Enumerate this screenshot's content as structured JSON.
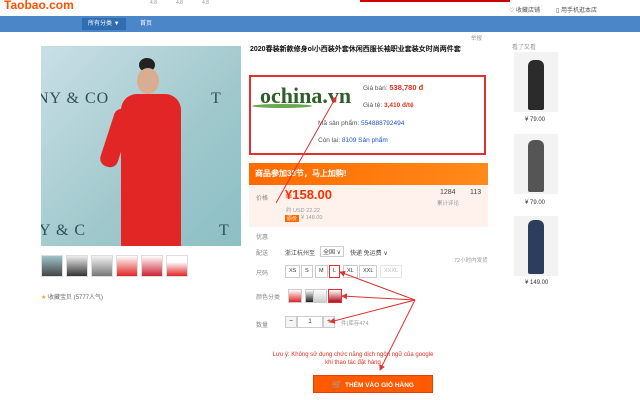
{
  "header": {
    "logo": "Taobao.com",
    "mini": [
      "4.8",
      "4.8",
      "4.8"
    ],
    "links": [
      "收藏店铺",
      "用手机逛本店"
    ]
  },
  "nav": {
    "items": [
      {
        "label": "所有分类 ▼"
      },
      {
        "label": "首页"
      }
    ]
  },
  "gallery": {
    "brand_left": "NY & CO",
    "brand_right": "T",
    "brand_bottom_left": "Y & C",
    "brand_bottom_right": "T",
    "favorites": "收藏宝贝 (5777人气)"
  },
  "product": {
    "report": "举报",
    "title": "2020春装新款修身ol小西装外套休闲西服长袖职业套装女时尚两件套",
    "ochina": {
      "logo": "ochina.vn",
      "price_label": "Giá bán:",
      "price_value": "538,780 đ",
      "rate_label": "Giá tệ:",
      "rate_value": "3,410 đ/tệ",
      "sku_label": "Mã sản phẩm:",
      "sku_value": "554888792494",
      "stock_label": "Còn lại:",
      "stock_value": "8109 Sản phẩm"
    },
    "promo": "商品参加38节，马上加购!",
    "price_label": "价格",
    "price": "¥158.00",
    "price_usd": "约 USD 22.22",
    "old_badge": "原价",
    "old_price": "¥ 148.00",
    "count1": "1284",
    "count1_label": "累计评论",
    "count2": "113",
    "promo_label": "优惠",
    "ship_label": "配送",
    "ship_from": "浙江杭州至",
    "ship_to": "全国 ∨",
    "ship_fee": "快递 免运费 ∨",
    "ship_time": "72小时内发货",
    "size_label": "尺码",
    "sizes": [
      "XS",
      "S",
      "M",
      "L",
      "XL",
      "XXL",
      "XXXL"
    ],
    "color_label": "颜色分类",
    "qty_label": "数量",
    "qty_minus": "−",
    "qty_value": "1",
    "qty_plus": "+",
    "stock": "件(库存474"
  },
  "notice": {
    "line1": "Lưu ý: Không sử dụng chức năng dịch ngôn ngữ của google",
    "line2": "khi thao tác đặt hàng"
  },
  "cart": {
    "label": "THÊM VÀO GIỎ HÀNG"
  },
  "sidebar": {
    "heading": "看了又看",
    "items": [
      {
        "price": "¥ 79.00"
      },
      {
        "price": "¥ 79.00"
      },
      {
        "price": "¥ 149.00"
      }
    ]
  },
  "colors": {
    "accent": "#ff5000",
    "annotation": "#e03030",
    "nav": "#4a86c8"
  }
}
